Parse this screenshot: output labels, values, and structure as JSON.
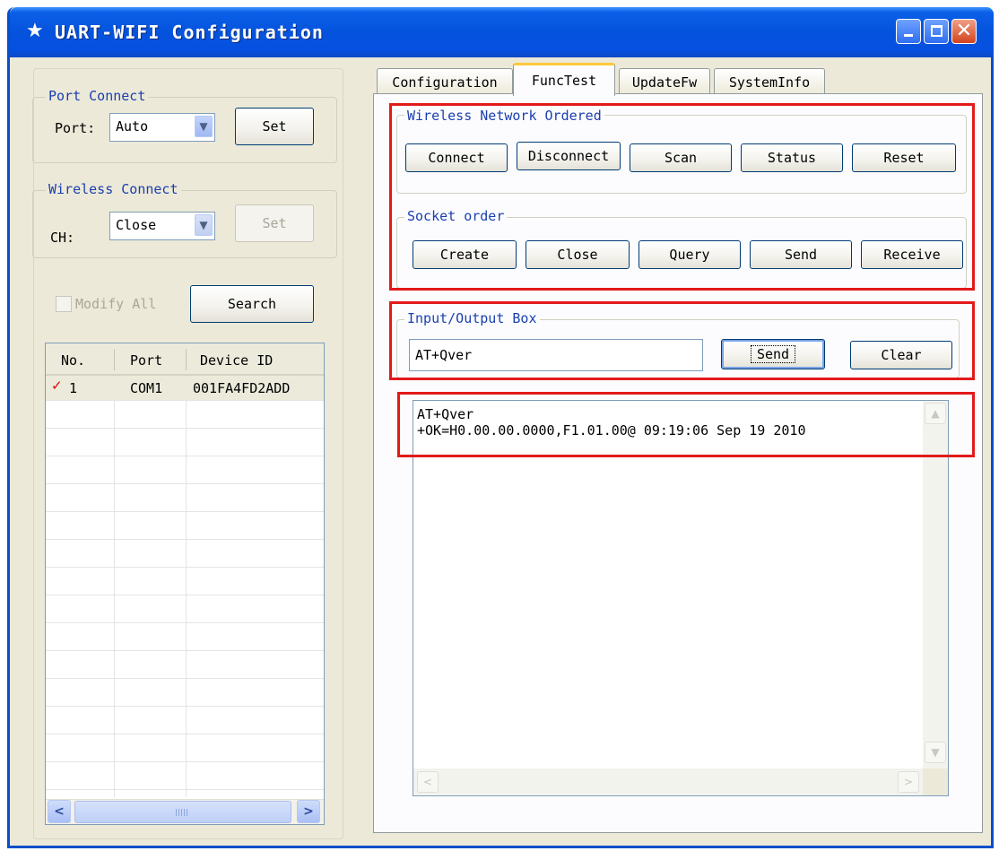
{
  "window": {
    "title": "UART-WIFI Configuration",
    "title_icon": "star-icon",
    "controls": [
      "minimize",
      "maximize",
      "close"
    ]
  },
  "left": {
    "port_connect": {
      "legend": "Port Connect",
      "port_label": "Port:",
      "port_value": "Auto",
      "set_label": "Set"
    },
    "wireless_connect": {
      "legend": "Wireless Connect",
      "ch_label": "CH:",
      "ch_value": "Close",
      "set_label": "Set"
    },
    "modify_all_label": "Modify All",
    "search_label": "Search",
    "device_list": {
      "columns": [
        "No.",
        "Port",
        "Device ID"
      ],
      "rows": [
        {
          "checked": true,
          "no": "1",
          "port": "COM1",
          "device_id": "001FA4FD2ADD"
        }
      ]
    }
  },
  "tabs": [
    {
      "label": "Configuration",
      "active": false
    },
    {
      "label": "FuncTest",
      "active": true
    },
    {
      "label": "UpdateFw",
      "active": false
    },
    {
      "label": "SystemInfo",
      "active": false
    }
  ],
  "functest": {
    "wireless_network": {
      "legend": "Wireless Network Ordered",
      "buttons": [
        "Connect",
        "Disconnect",
        "Scan",
        "Status",
        "Reset"
      ]
    },
    "socket_order": {
      "legend": "Socket order",
      "buttons": [
        "Create",
        "Close",
        "Query",
        "Send",
        "Receive"
      ]
    },
    "io_box": {
      "legend": "Input/Output Box",
      "input_value": "AT+Qver",
      "send_label": "Send",
      "clear_label": "Clear"
    },
    "output_lines": [
      "AT+Qver",
      "+OK=H0.00.00.0000,F1.01.00@ 09:19:06 Sep 19 2010"
    ]
  },
  "annotation_color": "#e21a1a",
  "accent": "#0553dd"
}
